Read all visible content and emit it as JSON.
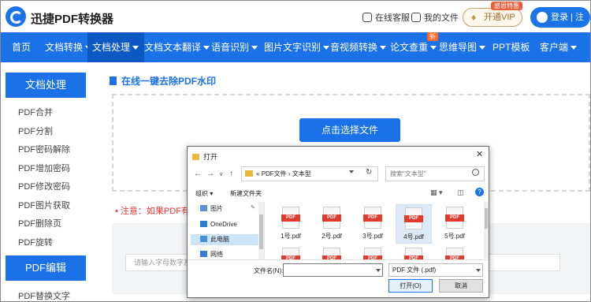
{
  "header": {
    "logo_text": "迅捷PDF转换器",
    "support": "在线客服",
    "my_files": "我的文件",
    "vip_label": "开通VIP",
    "vip_badge": "感恩特惠",
    "login": "登录 | 注册"
  },
  "nav": {
    "items": [
      {
        "label": "首页",
        "dropdown": false
      },
      {
        "label": "文档转换",
        "dropdown": true
      },
      {
        "label": "文档处理",
        "dropdown": true,
        "active": true
      },
      {
        "label": "文档文本翻译",
        "dropdown": true
      },
      {
        "label": "语音识别",
        "dropdown": true
      },
      {
        "label": "图片文字识别",
        "dropdown": true
      },
      {
        "label": "音视频转换",
        "dropdown": true
      },
      {
        "label": "论文查重",
        "dropdown": true
      },
      {
        "label": "思维导图",
        "dropdown": true
      },
      {
        "label": "PPT模板",
        "dropdown": false
      },
      {
        "label": "客户端",
        "dropdown": true
      }
    ],
    "new_badge": "新"
  },
  "sidebar": {
    "section1": "文档处理",
    "items": [
      "PDF合并",
      "PDF分割",
      "PDF密码解除",
      "PDF增加密码",
      "PDF修改密码",
      "PDF图片获取",
      "PDF删除页",
      "PDF旋转"
    ],
    "section2": "PDF编辑",
    "items2": [
      "PDF替换文字"
    ]
  },
  "main": {
    "title": "在线一键去除PDF水印",
    "choose_button": "点击选择文件",
    "notice": "• 注意：如果PDF有",
    "input_placeholder": "请输入字母数字及"
  },
  "dialog": {
    "title": "打开",
    "close": "✕",
    "breadcrumb": {
      "prefix": "«",
      "folder": "PDF文件",
      "sep": "›",
      "current": "文本型"
    },
    "search_placeholder": "搜索\"文本型\"",
    "toolbar": {
      "organize": "组织 ▾",
      "new_folder": "新建文件夹"
    },
    "tree": [
      {
        "label": "图片",
        "color": "#5a8fd6"
      },
      {
        "label": "OneDrive",
        "color": "#2b7cd3"
      },
      {
        "label": "此电脑",
        "color": "#4a90d9",
        "selected": true
      },
      {
        "label": "网络",
        "color": "#3a7bd5"
      }
    ],
    "files": [
      {
        "name": "1号.pdf"
      },
      {
        "name": "2号.pdf"
      },
      {
        "name": "3号.pdf"
      },
      {
        "name": "4号.pdf",
        "selected": true
      },
      {
        "name": "5号.pdf"
      },
      {
        "name": ""
      },
      {
        "name": ""
      },
      {
        "name": ""
      },
      {
        "name": ""
      },
      {
        "name": ""
      }
    ],
    "pdf_label": "PDF",
    "filename_label": "文件名(N):",
    "filetype": "PDF 文件 (.pdf)",
    "open_button": "打开(O)",
    "cancel_button": "取消"
  }
}
